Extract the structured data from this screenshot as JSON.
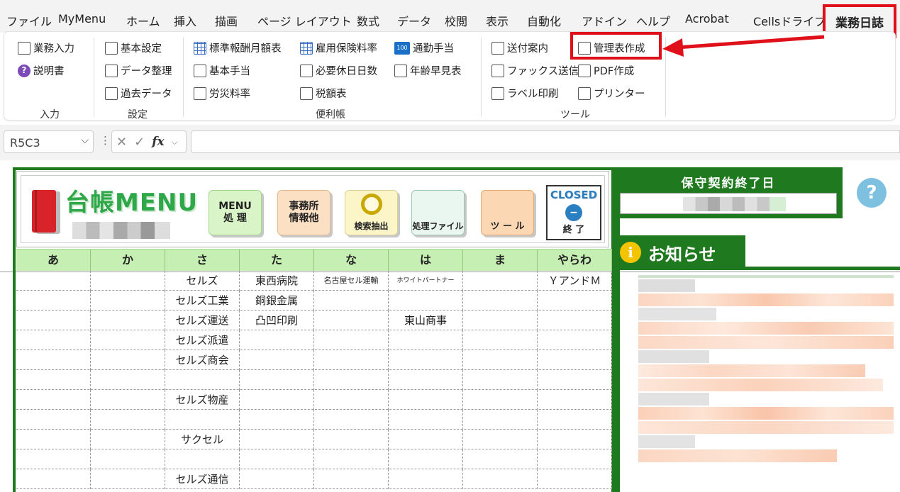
{
  "ribbon_tabs": [
    "ファイル",
    "MyMenu",
    "ホーム",
    "挿入",
    "描画",
    "ページ レイアウト",
    "数式",
    "データ",
    "校閲",
    "表示",
    "自動化",
    "アドイン",
    "ヘルプ",
    "Acrobat",
    "Cellsドライブ"
  ],
  "active_tab": "業務日誌",
  "groups": {
    "input": {
      "label": "入力",
      "items": [
        "業務入力",
        "説明書"
      ]
    },
    "settings": {
      "label": "設定",
      "items": [
        "基本設定",
        "データ整理",
        "過去データ"
      ]
    },
    "handy": {
      "label": "便利帳",
      "items": [
        "標準報酬月額表",
        "基本手当",
        "労災料率",
        "雇用保険料率",
        "必要休日日数",
        "税額表",
        "通勤手当",
        "年齢早見表"
      ]
    },
    "tools": {
      "label": "ツール",
      "items": [
        "送付案内",
        "ファックス送信",
        "ラベル印刷",
        "管理表作成",
        "PDF作成",
        "プリンター"
      ]
    }
  },
  "name_box": "R5C3",
  "formula_bar": {
    "cancel": "✕",
    "enter": "✓",
    "fx": "fx"
  },
  "menu": {
    "title": "台帳MENU",
    "buttons": [
      "MENU\n処 理",
      "事務所\n情報他",
      "検索抽出",
      "処理ファイル",
      "ツ ー ル"
    ],
    "closed_label": "CLOSED",
    "closed_sub": "終 了",
    "columns": [
      "あ",
      "か",
      "さ",
      "た",
      "な",
      "は",
      "ま",
      "やらわ"
    ],
    "rows": [
      [
        "",
        "",
        "セルズ",
        "東西病院",
        "名古屋セル運輸",
        "ホワイトパートナー",
        "",
        "ＹアンドＭ"
      ],
      [
        "",
        "",
        "セルズ工業",
        "銅銀金属",
        "",
        "",
        "",
        ""
      ],
      [
        "",
        "",
        "セルズ運送",
        "凸凹印刷",
        "",
        "東山商事",
        "",
        ""
      ],
      [
        "",
        "",
        "セルズ派遣",
        "",
        "",
        "",
        "",
        ""
      ],
      [
        "",
        "",
        "セルズ商会",
        "",
        "",
        "",
        "",
        ""
      ],
      [
        "",
        "",
        "",
        "",
        "",
        "",
        "",
        ""
      ],
      [
        "",
        "",
        "セルズ物産",
        "",
        "",
        "",
        "",
        ""
      ],
      [
        "",
        "",
        "",
        "",
        "",
        "",
        "",
        ""
      ],
      [
        "",
        "",
        "サクセル",
        "",
        "",
        "",
        "",
        ""
      ],
      [
        "",
        "",
        "",
        "",
        "",
        "",
        "",
        ""
      ],
      [
        "",
        "",
        "セルズ通信",
        "",
        "",
        "",
        "",
        ""
      ]
    ]
  },
  "maintenance": {
    "title": "保守契約終了日"
  },
  "news": {
    "title": "お知らせ"
  },
  "help_glyph": "?",
  "colors": {
    "accent_green": "#1f7a1f",
    "highlight_red": "#e0101a",
    "header_green": "#c6efb4"
  }
}
